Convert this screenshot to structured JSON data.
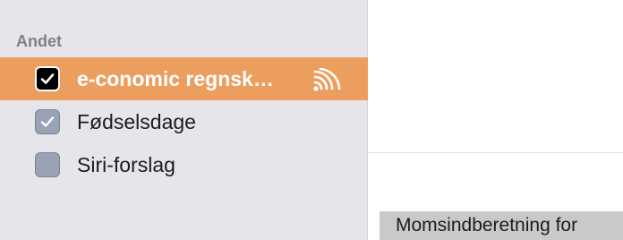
{
  "sidebar": {
    "section_title": "Andet",
    "items": [
      {
        "label": "e-conomic regnsk…",
        "checked": true,
        "selected": true,
        "icon": "subscription-broadcast-icon"
      },
      {
        "label": "Fødselsdage",
        "checked": true,
        "selected": false
      },
      {
        "label": "Siri-forslag",
        "checked": false,
        "selected": false
      }
    ]
  },
  "calendar": {
    "event_label": "Momsindberetning for"
  },
  "colors": {
    "selection": "#ec9e5f",
    "sidebar_bg": "#e6e6ea",
    "checkbox_slate": "#9aa3b6",
    "event_bg": "#c9c9c9"
  }
}
